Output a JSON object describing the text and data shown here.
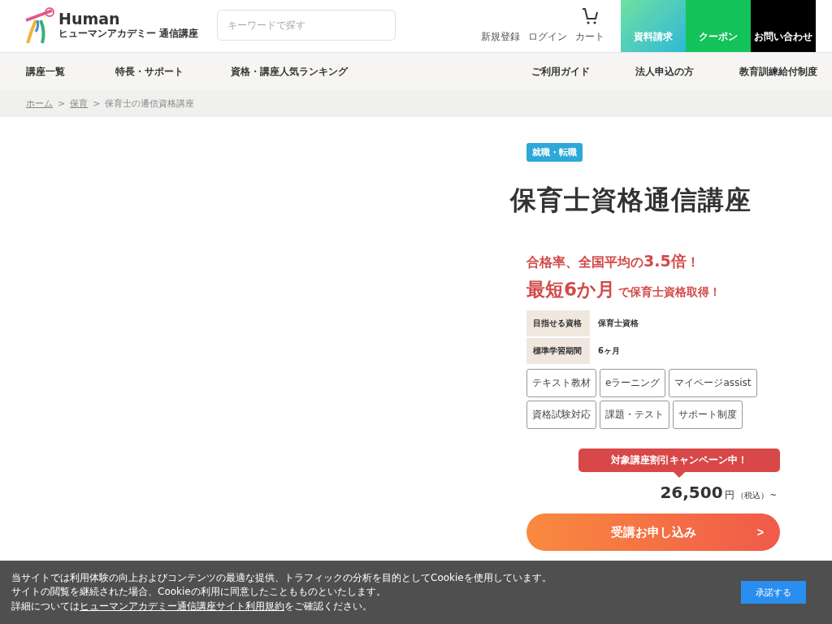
{
  "header": {
    "logo_word": "Human",
    "logo_sub": "ヒューマンアカデミー 通信講座",
    "search": {
      "placeholder": "キーワードで探す"
    },
    "links": [
      {
        "label": "新規登録"
      },
      {
        "label": "ログイン"
      },
      {
        "label": "カート",
        "kind": "cart"
      }
    ],
    "buttons": [
      {
        "label": "資料請求",
        "kind": "request"
      },
      {
        "label": "クーポン",
        "kind": "coupon"
      },
      {
        "label": "お問い合わせ",
        "kind": "contact"
      }
    ]
  },
  "nav": {
    "left": [
      "講座一覧",
      "特長・サポート",
      "資格・講座人気ランキング"
    ],
    "right": [
      "ご利用ガイド",
      "法人申込の方",
      "教育訓練給付制度"
    ]
  },
  "breadcrumb": [
    {
      "label": "ホーム",
      "link": true
    },
    {
      "separator": ">",
      "label": "保育",
      "link": true
    },
    {
      "separator": ">",
      "label": "保育士の通信資格講座",
      "link": false
    }
  ],
  "course": {
    "tag": "就職・転職",
    "title": "保育士資格通信講座",
    "catch1": "合格率、全国平均の**3.5倍**！",
    "catch2_big": "最短6か月",
    "catch2_small": "で保育士資格取得！",
    "info": [
      {
        "label": "目指せる資格",
        "value": "保育士資格"
      },
      {
        "label": "標準学習期間",
        "value": "6ヶ月"
      }
    ],
    "features": [
      [
        "テキスト教材",
        "eラーニング",
        "マイページassist"
      ],
      [
        "資格試験対応",
        "課題・テスト",
        "サポート制度"
      ]
    ],
    "campaign": "対象講座割引キャンペーン中！",
    "price": "26,500",
    "yen": "円",
    "tax": "（税込）",
    "tilde": "~",
    "apply": "受講お申し込み",
    "apply_arrow": ">"
  },
  "cookie": {
    "line1": "当サイトでは利用体験の向上およびコンテンツの最適な提供、トラフィックの分析を目的としてCookieを使用しています。",
    "line2": "サイトの閲覧を継続された場合、Cookieの利用に同意したこともものといたします。",
    "line3_pre": "詳細については",
    "line3_link": "ヒューマンアカデミー通信講座サイト利用規約",
    "line3_post": "をご確認ください。",
    "accept": "承諾する"
  }
}
